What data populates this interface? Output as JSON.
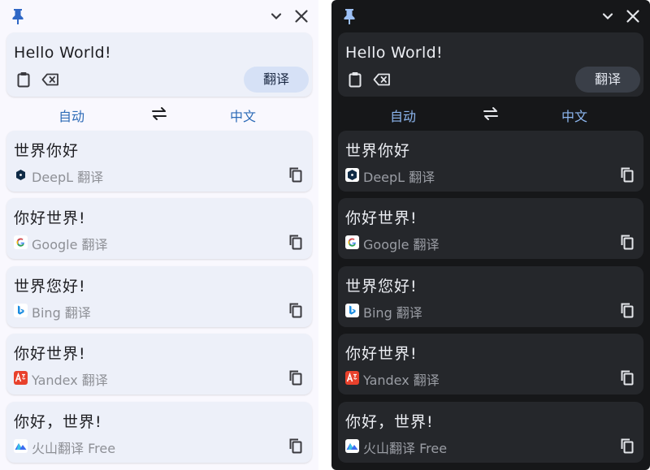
{
  "panels": [
    {
      "theme": "light",
      "input_text": "Hello World!",
      "translate_label": "翻译",
      "source_lang": "自动",
      "target_lang": "中文",
      "results": [
        {
          "text": "世界你好",
          "service": "DeepL 翻译",
          "icon": "deepl-icon"
        },
        {
          "text": "你好世界!",
          "service": "Google 翻译",
          "icon": "google-icon"
        },
        {
          "text": "世界您好!",
          "service": "Bing 翻译",
          "icon": "bing-icon"
        },
        {
          "text": "你好世界!",
          "service": "Yandex 翻译",
          "icon": "yandex-icon"
        },
        {
          "text": "你好，世界!",
          "service": "火山翻译 Free",
          "icon": "volcano-icon"
        }
      ]
    },
    {
      "theme": "dark",
      "input_text": "Hello World!",
      "translate_label": "翻译",
      "source_lang": "自动",
      "target_lang": "中文",
      "results": [
        {
          "text": "世界你好",
          "service": "DeepL 翻译",
          "icon": "deepl-icon"
        },
        {
          "text": "你好世界!",
          "service": "Google 翻译",
          "icon": "google-icon"
        },
        {
          "text": "世界您好!",
          "service": "Bing 翻译",
          "icon": "bing-icon"
        },
        {
          "text": "你好世界!",
          "service": "Yandex 翻译",
          "icon": "yandex-icon"
        },
        {
          "text": "你好，世界!",
          "service": "火山翻译 Free",
          "icon": "volcano-icon"
        }
      ]
    }
  ],
  "colors": {
    "accent_light": "#2d6bb7",
    "accent_dark": "#8db7f0",
    "pin_light": "#2f67c5",
    "pin_dark": "#9cc0f5"
  }
}
